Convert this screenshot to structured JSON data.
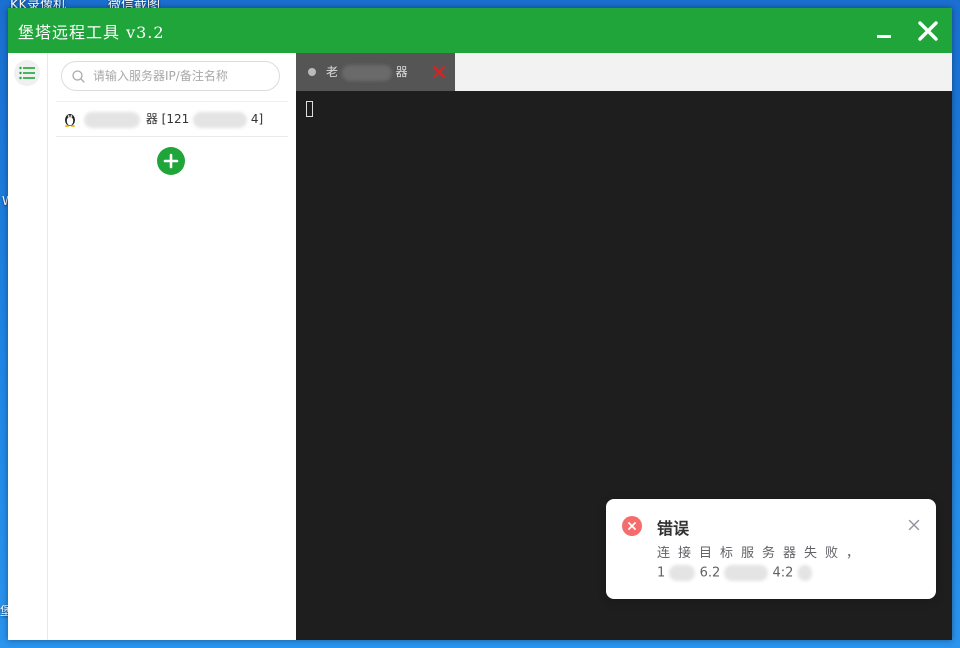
{
  "desktop": {
    "icon1_label": "KK录像机",
    "icon2_label": "微信截图",
    "frag_left": "W",
    "frag_bottom": "堡"
  },
  "window": {
    "title": "堡塔远程工具  v3.2"
  },
  "sidebar": {
    "search_placeholder": "请输入服务器IP/备注名称",
    "servers": [
      {
        "name_visible": "器",
        "ip_prefix": "[121",
        "ip_suffix": "4]"
      }
    ]
  },
  "terminal": {
    "tabs": [
      {
        "label_start": "老",
        "label_end": "器"
      }
    ]
  },
  "toast": {
    "title": "错误",
    "message": "连接目标服务器失败，",
    "detail_prefix": "1",
    "detail_mid": "6.2",
    "detail_suffix": "4:2"
  },
  "colors": {
    "brand_green": "#20a53a",
    "error_red": "#f56c6c",
    "tab_close_red": "#e02020",
    "terminal_bg": "#1e1e1e"
  }
}
